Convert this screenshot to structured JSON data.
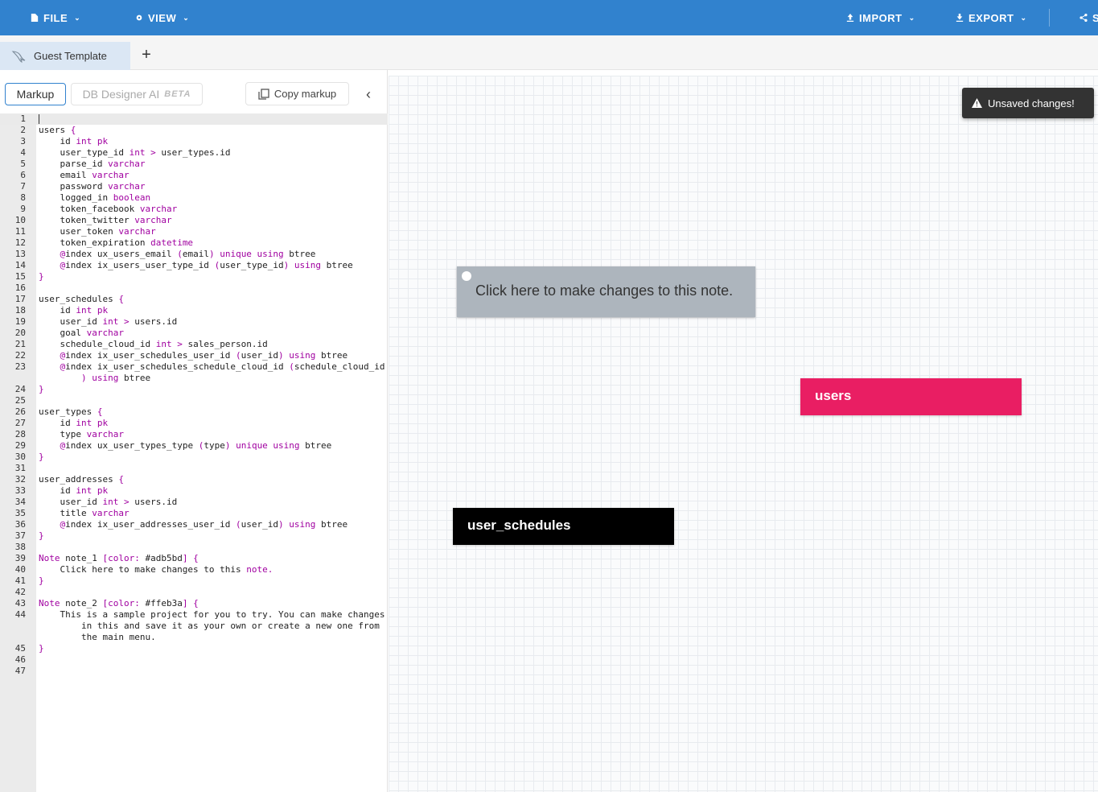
{
  "topbar": {
    "bg": "#3182ce",
    "menus": {
      "file": "FILE",
      "view": "VIEW",
      "import": "IMPORT",
      "export": "EXPORT",
      "share": "S"
    }
  },
  "tabs": [
    {
      "label": "Guest Template",
      "icon": "mysql-dolphin-icon"
    }
  ],
  "add_tab": "+",
  "toolbar": {
    "markup": "Markup",
    "ai": "DB Designer AI",
    "ai_badge": "BETA",
    "copy": "Copy markup",
    "collapse": "‹"
  },
  "editor": {
    "lines": [
      {
        "n": "1",
        "parts": [
          [
            "",
            ""
          ]
        ]
      },
      {
        "n": "2",
        "parts": [
          [
            "users ",
            ""
          ],
          [
            "{",
            "kw"
          ]
        ]
      },
      {
        "n": "3",
        "parts": [
          [
            "    id ",
            ""
          ],
          [
            "int pk",
            "kw"
          ]
        ]
      },
      {
        "n": "4",
        "parts": [
          [
            "    user_type_id ",
            ""
          ],
          [
            "int > ",
            "kw"
          ],
          [
            "user_types.id",
            ""
          ]
        ]
      },
      {
        "n": "5",
        "parts": [
          [
            "    parse_id ",
            ""
          ],
          [
            "varchar",
            "kw"
          ]
        ]
      },
      {
        "n": "6",
        "parts": [
          [
            "    email ",
            ""
          ],
          [
            "varchar",
            "kw"
          ]
        ]
      },
      {
        "n": "7",
        "parts": [
          [
            "    password ",
            ""
          ],
          [
            "varchar",
            "kw"
          ]
        ]
      },
      {
        "n": "8",
        "parts": [
          [
            "    logged_in ",
            ""
          ],
          [
            "boolean",
            "kw"
          ]
        ]
      },
      {
        "n": "9",
        "parts": [
          [
            "    token_facebook ",
            ""
          ],
          [
            "varchar",
            "kw"
          ]
        ]
      },
      {
        "n": "10",
        "parts": [
          [
            "    token_twitter ",
            ""
          ],
          [
            "varchar",
            "kw"
          ]
        ]
      },
      {
        "n": "11",
        "parts": [
          [
            "    user_token ",
            ""
          ],
          [
            "varchar",
            "kw"
          ]
        ]
      },
      {
        "n": "12",
        "parts": [
          [
            "    token_expiration ",
            ""
          ],
          [
            "datetime",
            "kw"
          ]
        ]
      },
      {
        "n": "13",
        "parts": [
          [
            "    ",
            ""
          ],
          [
            "@",
            "kw"
          ],
          [
            "index ux_users_email ",
            ""
          ],
          [
            "(",
            "kw"
          ],
          [
            "email",
            ""
          ],
          [
            ") unique using ",
            "kw"
          ],
          [
            "btree",
            ""
          ]
        ]
      },
      {
        "n": "14",
        "parts": [
          [
            "    ",
            ""
          ],
          [
            "@",
            "kw"
          ],
          [
            "index ix_users_user_type_id ",
            ""
          ],
          [
            "(",
            "kw"
          ],
          [
            "user_type_id",
            ""
          ],
          [
            ") using ",
            "kw"
          ],
          [
            "btree",
            ""
          ]
        ]
      },
      {
        "n": "15",
        "parts": [
          [
            "}",
            "kw"
          ]
        ]
      },
      {
        "n": "16",
        "parts": [
          [
            "",
            ""
          ]
        ]
      },
      {
        "n": "17",
        "parts": [
          [
            "user_schedules ",
            ""
          ],
          [
            "{",
            "kw"
          ]
        ]
      },
      {
        "n": "18",
        "parts": [
          [
            "    id ",
            ""
          ],
          [
            "int pk",
            "kw"
          ]
        ]
      },
      {
        "n": "19",
        "parts": [
          [
            "    user_id ",
            ""
          ],
          [
            "int > ",
            "kw"
          ],
          [
            "users.id",
            ""
          ]
        ]
      },
      {
        "n": "20",
        "parts": [
          [
            "    goal ",
            ""
          ],
          [
            "varchar",
            "kw"
          ]
        ]
      },
      {
        "n": "21",
        "parts": [
          [
            "    schedule_cloud_id ",
            ""
          ],
          [
            "int > ",
            "kw"
          ],
          [
            "sales_person.id",
            ""
          ]
        ]
      },
      {
        "n": "22",
        "parts": [
          [
            "    ",
            ""
          ],
          [
            "@",
            "kw"
          ],
          [
            "index ix_user_schedules_user_id ",
            ""
          ],
          [
            "(",
            "kw"
          ],
          [
            "user_id",
            ""
          ],
          [
            ") using ",
            "kw"
          ],
          [
            "btree",
            ""
          ]
        ]
      },
      {
        "n": "23",
        "parts": [
          [
            "    ",
            ""
          ],
          [
            "@",
            "kw"
          ],
          [
            "index ix_user_schedules_schedule_cloud_id ",
            ""
          ],
          [
            "(",
            "kw"
          ],
          [
            "schedule_cloud_id",
            ""
          ]
        ]
      },
      {
        "n": "",
        "parts": [
          [
            "        ",
            ""
          ],
          [
            ") using ",
            "kw"
          ],
          [
            "btree",
            ""
          ]
        ]
      },
      {
        "n": "24",
        "parts": [
          [
            "}",
            "kw"
          ]
        ]
      },
      {
        "n": "25",
        "parts": [
          [
            "",
            ""
          ]
        ]
      },
      {
        "n": "26",
        "parts": [
          [
            "user_types ",
            ""
          ],
          [
            "{",
            "kw"
          ]
        ]
      },
      {
        "n": "27",
        "parts": [
          [
            "    id ",
            ""
          ],
          [
            "int pk",
            "kw"
          ]
        ]
      },
      {
        "n": "28",
        "parts": [
          [
            "    type ",
            ""
          ],
          [
            "varchar",
            "kw"
          ]
        ]
      },
      {
        "n": "29",
        "parts": [
          [
            "    ",
            ""
          ],
          [
            "@",
            "kw"
          ],
          [
            "index ux_user_types_type ",
            ""
          ],
          [
            "(",
            "kw"
          ],
          [
            "type",
            ""
          ],
          [
            ") unique using ",
            "kw"
          ],
          [
            "btree",
            ""
          ]
        ]
      },
      {
        "n": "30",
        "parts": [
          [
            "}",
            "kw"
          ]
        ]
      },
      {
        "n": "31",
        "parts": [
          [
            "",
            ""
          ]
        ]
      },
      {
        "n": "32",
        "parts": [
          [
            "user_addresses ",
            ""
          ],
          [
            "{",
            "kw"
          ]
        ]
      },
      {
        "n": "33",
        "parts": [
          [
            "    id ",
            ""
          ],
          [
            "int pk",
            "kw"
          ]
        ]
      },
      {
        "n": "34",
        "parts": [
          [
            "    user_id ",
            ""
          ],
          [
            "int > ",
            "kw"
          ],
          [
            "users.id",
            ""
          ]
        ]
      },
      {
        "n": "35",
        "parts": [
          [
            "    title ",
            ""
          ],
          [
            "varchar",
            "kw"
          ]
        ]
      },
      {
        "n": "36",
        "parts": [
          [
            "    ",
            ""
          ],
          [
            "@",
            "kw"
          ],
          [
            "index ix_user_addresses_user_id ",
            ""
          ],
          [
            "(",
            "kw"
          ],
          [
            "user_id",
            ""
          ],
          [
            ") using ",
            "kw"
          ],
          [
            "btree",
            ""
          ]
        ]
      },
      {
        "n": "37",
        "parts": [
          [
            "}",
            "kw"
          ]
        ]
      },
      {
        "n": "38",
        "parts": [
          [
            "",
            ""
          ]
        ]
      },
      {
        "n": "39",
        "parts": [
          [
            "Note ",
            "kw"
          ],
          [
            "note_1 ",
            ""
          ],
          [
            "[color: ",
            "kw"
          ],
          [
            "#adb5bd",
            ""
          ],
          [
            "] {",
            "kw"
          ]
        ]
      },
      {
        "n": "40",
        "parts": [
          [
            "    Click here to make changes to this ",
            ""
          ],
          [
            "note.",
            "kw"
          ]
        ]
      },
      {
        "n": "41",
        "parts": [
          [
            "}",
            "kw"
          ]
        ]
      },
      {
        "n": "42",
        "parts": [
          [
            "",
            ""
          ]
        ]
      },
      {
        "n": "43",
        "parts": [
          [
            "Note ",
            "kw"
          ],
          [
            "note_2 ",
            ""
          ],
          [
            "[color: ",
            "kw"
          ],
          [
            "#ffeb3a",
            ""
          ],
          [
            "] {",
            "kw"
          ]
        ]
      },
      {
        "n": "44",
        "parts": [
          [
            "    This is a sample project for you to try. You can make changes",
            ""
          ]
        ]
      },
      {
        "n": "",
        "parts": [
          [
            "        in this and save it as your own or create a new one from",
            ""
          ]
        ]
      },
      {
        "n": "",
        "parts": [
          [
            "        the main menu.",
            ""
          ]
        ]
      },
      {
        "n": "45",
        "parts": [
          [
            "}",
            "kw"
          ]
        ]
      },
      {
        "n": "46",
        "parts": [
          [
            "",
            ""
          ]
        ]
      },
      {
        "n": "47",
        "parts": [
          [
            "",
            ""
          ]
        ]
      }
    ]
  },
  "canvas": {
    "note": {
      "text": "Click here to make changes to this note.",
      "color": "#adb5bd"
    },
    "tables": [
      {
        "name": "users",
        "color": "#e91e63"
      },
      {
        "name": "user_schedules",
        "color": "#000000"
      }
    ]
  },
  "toast": {
    "text": "Unsaved changes!"
  }
}
